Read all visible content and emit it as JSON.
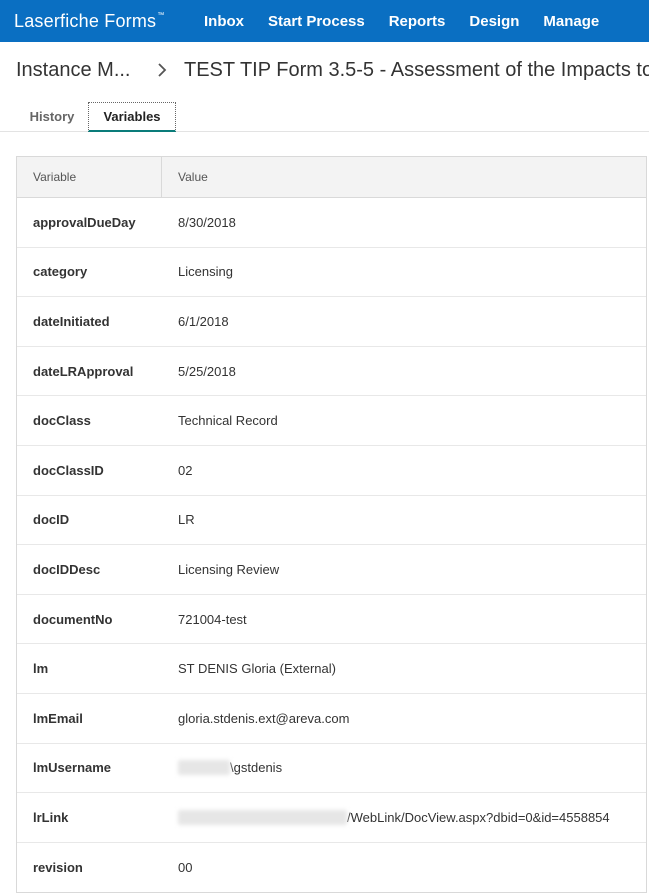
{
  "app": {
    "brand": "Laserfiche Forms",
    "brand_mark": "™",
    "nav": [
      "Inbox",
      "Start Process",
      "Reports",
      "Design",
      "Manage"
    ]
  },
  "breadcrumb": {
    "parent": "Instance M...",
    "current": "TEST TIP Form 3.5-5 - Assessment of the Impacts to"
  },
  "tabs": [
    {
      "label": "History",
      "active": false
    },
    {
      "label": "Variables",
      "active": true
    }
  ],
  "table": {
    "headers": {
      "variable": "Variable",
      "value": "Value"
    },
    "rows": [
      {
        "name": "approvalDueDay",
        "value": "8/30/2018"
      },
      {
        "name": "category",
        "value": "Licensing"
      },
      {
        "name": "dateInitiated",
        "value": "6/1/2018"
      },
      {
        "name": "dateLRApproval",
        "value": "5/25/2018"
      },
      {
        "name": "docClass",
        "value": "Technical Record"
      },
      {
        "name": "docClassID",
        "value": "02"
      },
      {
        "name": "docID",
        "value": "LR"
      },
      {
        "name": "docIDDesc",
        "value": "Licensing Review"
      },
      {
        "name": "documentNo",
        "value": "721004-test"
      },
      {
        "name": "lm",
        "value": "ST DENIS Gloria (External)"
      },
      {
        "name": "lmEmail",
        "value": "gloria.stdenis.ext@areva.com"
      },
      {
        "name": "lmUsername",
        "value": "\\gstdenis"
      },
      {
        "name": "lrLink",
        "value": "/WebLink/DocView.aspx?dbid=0&id=4558854"
      },
      {
        "name": "revision",
        "value": "00"
      }
    ]
  },
  "colors": {
    "topbar": "#0a6fc2",
    "active_tab_underline": "#0a7c7a"
  }
}
